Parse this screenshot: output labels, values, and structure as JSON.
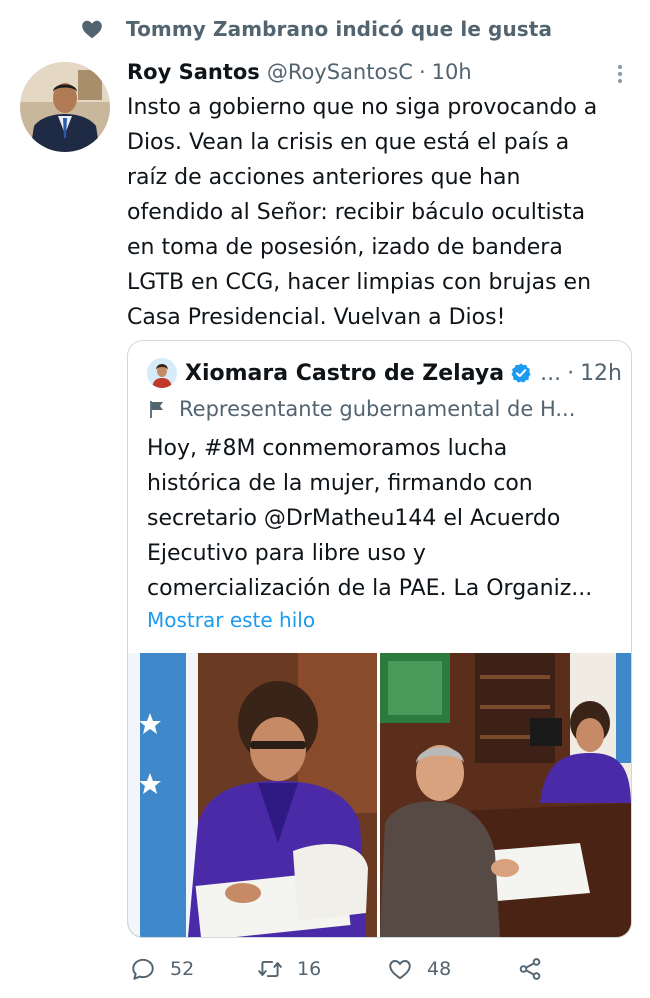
{
  "social_context": {
    "icon": "heart-icon",
    "text": "Tommy Zambrano indicó que le gusta"
  },
  "tweet": {
    "author_name": "Roy Santos",
    "author_handle": "@RoySantosC",
    "separator": "·",
    "time": "10h",
    "text": "Insto a gobierno que no siga provocando a\nDios. Vean la crisis en que está el país a\nraíz de acciones anteriores que han\nofendido al Señor: recibir báculo ocultista\nen toma de posesión, izado de bandera\nLGTB en CCG, hacer limpias con brujas en\nCasa Presidencial. Vuelvan a Dios!"
  },
  "quote": {
    "author_name": "Xiomara Castro de Zelaya",
    "verified": true,
    "ellipsis": "...",
    "separator": "·",
    "time": "12h",
    "label": "Representante gubernamental de H...",
    "text": "Hoy, #8M conmemoramos lucha\nhistórica de la mujer, firmando con\nsecretario @DrMatheu144 el Acuerdo\nEjecutivo para libre uso y\ncomercialización de la PAE. La Organiz...",
    "show_thread": "Mostrar este hilo"
  },
  "actions": {
    "replies": "52",
    "retweets": "16",
    "likes": "48"
  },
  "colors": {
    "text": "#0f1419",
    "secondary": "#536471",
    "link": "#1d9bf0",
    "border": "#cfd9de"
  }
}
